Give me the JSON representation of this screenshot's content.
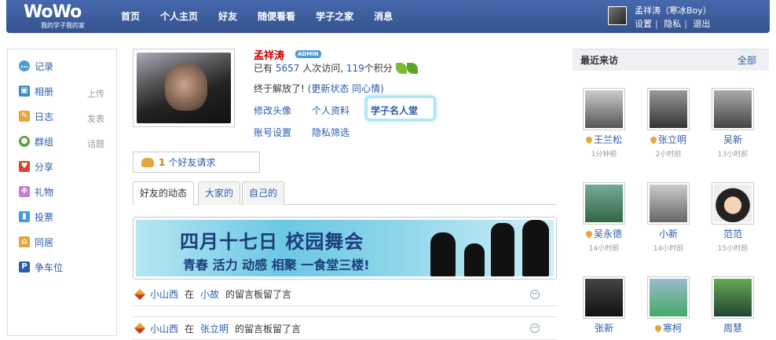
{
  "header": {
    "logo_text": "WoWo",
    "logo_tagline": "我的学子我的家",
    "nav": [
      "首页",
      "个人主页",
      "好友",
      "随便看看",
      "学子之家",
      "消息"
    ],
    "user_name": "孟祥涛（寒冰Boy）",
    "user_links": [
      "设置",
      "隐私",
      "退出"
    ]
  },
  "sidebar": {
    "items": [
      {
        "label": "记录",
        "sub": "",
        "icon": "bubble-icon",
        "color": "#4a9ad8"
      },
      {
        "label": "相册",
        "sub": "上传",
        "icon": "photo-icon",
        "color": "#3a8ac8"
      },
      {
        "label": "日志",
        "sub": "发表",
        "icon": "diary-icon",
        "color": "#e7a63b"
      },
      {
        "label": "群组",
        "sub": "话题",
        "icon": "group-icon",
        "color": "#5aa03a"
      },
      {
        "label": "分享",
        "sub": "",
        "icon": "heart-icon",
        "color": "#d9442f"
      },
      {
        "label": "礼物",
        "sub": "",
        "icon": "gift-icon",
        "color": "#c97bd6"
      },
      {
        "label": "投票",
        "sub": "",
        "icon": "chart-icon",
        "color": "#4a9ad8"
      },
      {
        "label": "同居",
        "sub": "",
        "icon": "house-icon",
        "color": "#e7a63b"
      },
      {
        "label": "争车位",
        "sub": "",
        "icon": "parking-icon",
        "color": "#2a5caa"
      }
    ]
  },
  "profile": {
    "name": "孟祥涛",
    "badge": "ADMIN",
    "stats_prefix": "已有",
    "visits": "5657",
    "visits_suffix": "人次访问,",
    "points": "119",
    "points_suffix": "个积分",
    "status_text": "终于解放了!",
    "status_update": "(更新状态",
    "status_sympathy": "同心情)",
    "links_row1": [
      "修改头像",
      "个人资料",
      "学子名人堂"
    ],
    "links_row2": [
      "账号设置",
      "隐私筛选"
    ]
  },
  "friend_request": {
    "count": "1",
    "label": "个好友请求"
  },
  "tabs": [
    "好友的动态",
    "大家的",
    "自己的"
  ],
  "banner": {
    "title": "四月十七日 校园舞会",
    "subtitle": "青春 活力 动感 相聚 一食堂三楼!"
  },
  "feed": [
    {
      "user": "小山西",
      "in": "在",
      "target": "小故",
      "action": "的留言板留了言"
    },
    {
      "user": "小山西",
      "in": "在",
      "target": "张立明",
      "action": "的留言板留了言"
    }
  ],
  "visitors": {
    "title": "最近来访",
    "all_label": "全部",
    "list": [
      {
        "name": "王兰松",
        "time": "1分钟前",
        "online": true
      },
      {
        "name": "张立明",
        "time": "2小时前",
        "online": true
      },
      {
        "name": "吴新",
        "time": "13小时前",
        "online": false
      },
      {
        "name": "吴永德",
        "time": "14小时前",
        "online": true
      },
      {
        "name": "小新",
        "time": "14小时前",
        "online": false
      },
      {
        "name": "范范",
        "time": "15小时前",
        "online": false
      },
      {
        "name": "张新",
        "time": "",
        "online": false
      },
      {
        "name": "寒柯",
        "time": "",
        "online": true
      },
      {
        "name": "周慧",
        "time": "",
        "online": false
      }
    ]
  }
}
